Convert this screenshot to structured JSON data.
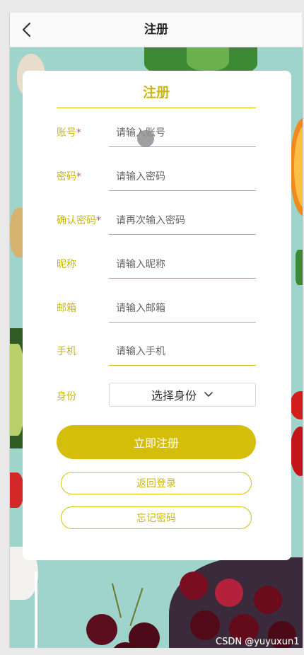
{
  "header": {
    "title": "注册"
  },
  "form": {
    "title": "注册",
    "fields": [
      {
        "label": "账号",
        "required": "*",
        "placeholder": "请输入账号"
      },
      {
        "label": "密码",
        "required": "*",
        "placeholder": "请输入密码"
      },
      {
        "label": "确认密码",
        "required": "*",
        "placeholder": "请再次输入密码"
      },
      {
        "label": "昵称",
        "required": "",
        "placeholder": "请输入昵称"
      },
      {
        "label": "邮箱",
        "required": "",
        "placeholder": "请输入邮箱"
      },
      {
        "label": "手机",
        "required": "",
        "placeholder": "请输入手机"
      }
    ],
    "role": {
      "label": "身份",
      "selected": "选择身份"
    },
    "register_button": "立即注册",
    "back_login_button": "返回登录",
    "forgot_password_button": "忘记密码"
  },
  "watermark": "CSDN @yuyuxun1",
  "colors": {
    "accent": "#d4be09",
    "label": "#c9b812",
    "required": "#d4534a",
    "background": "#9fd4cc"
  },
  "icons": {
    "back": "chevron-left-icon",
    "dropdown": "chevron-down-icon"
  }
}
